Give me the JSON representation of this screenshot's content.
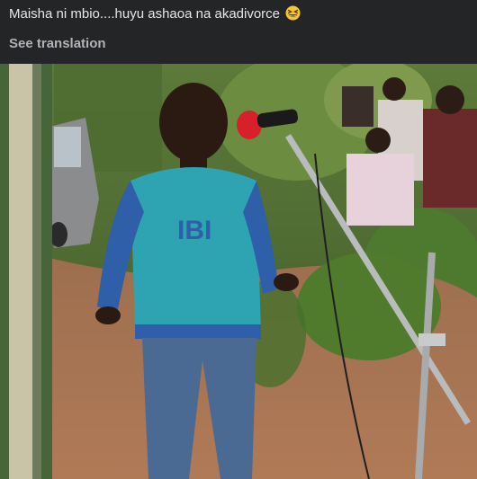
{
  "post": {
    "caption": "Maisha ni mbio....huyu ashaoa na akadivorce",
    "caption_emoji": "grinning-squinting-face-icon",
    "see_translation": "See translation"
  },
  "photo": {
    "shirt_text": "IBI"
  },
  "colors": {
    "background": "#242526",
    "caption_text": "#e4e6eb",
    "secondary_text": "#b0b3b8"
  }
}
